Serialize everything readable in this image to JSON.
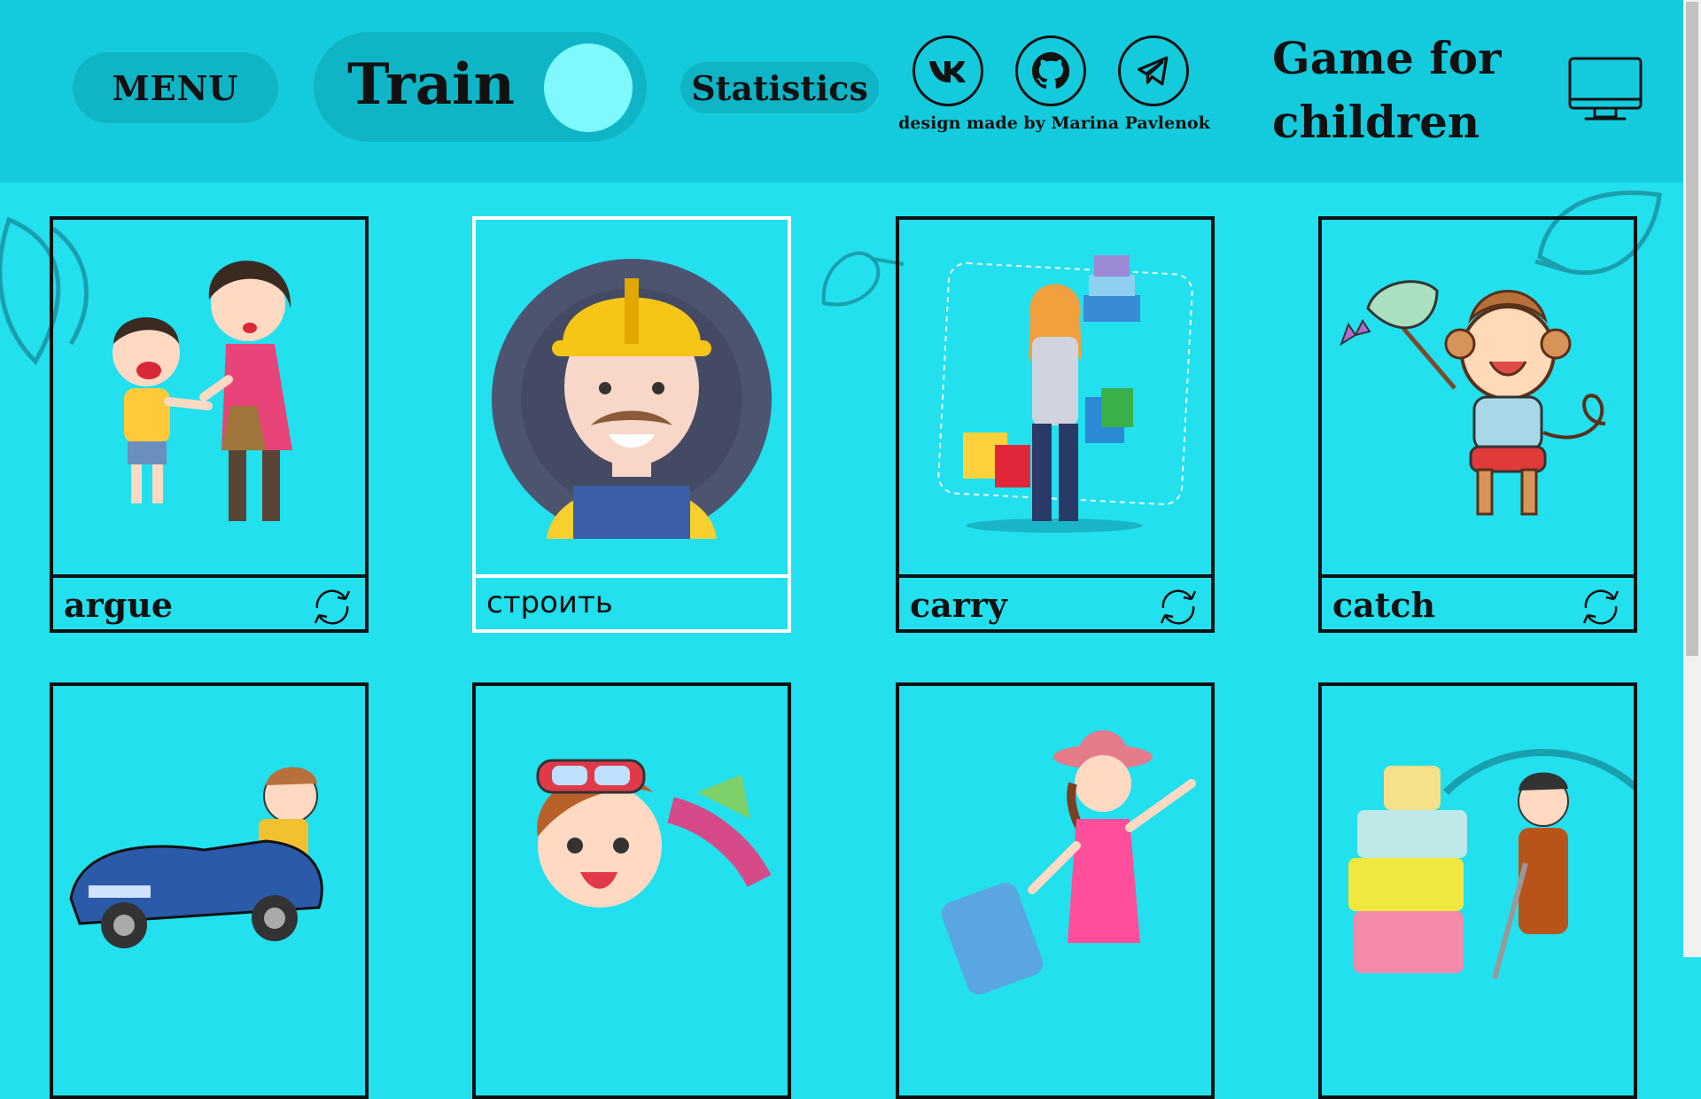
{
  "header": {
    "menu_label": "MENU",
    "mode_label": "Train",
    "statistics_label": "Statistics",
    "social": [
      {
        "name": "vk",
        "icon": "vk-icon"
      },
      {
        "name": "github",
        "icon": "github-icon"
      },
      {
        "name": "telegram",
        "icon": "telegram-icon"
      }
    ],
    "credit": "design made by Marina Pavlenok",
    "title": "Game for children",
    "device_icon": "monitor-icon"
  },
  "cards": [
    {
      "word": "argue",
      "flipped": false,
      "image": "boy-arguing-with-mother"
    },
    {
      "word": "строить",
      "flipped": true,
      "image": "builder-avatar"
    },
    {
      "word": "carry",
      "flipped": false,
      "image": "woman-carrying-shopping-bags"
    },
    {
      "word": "catch",
      "flipped": false,
      "image": "monkey-catching-butterfly"
    },
    {
      "word": "",
      "image": "man-driving-car"
    },
    {
      "word": "",
      "image": "boy-diving"
    },
    {
      "word": "",
      "image": "girl-with-suitcase"
    },
    {
      "word": "",
      "image": "man-with-luggage-stack"
    }
  ],
  "colors": {
    "background": "#22e0ee",
    "header": "#14cbdd",
    "button": "#0fb5c6",
    "toggle_knob": "#7ff8ff"
  }
}
